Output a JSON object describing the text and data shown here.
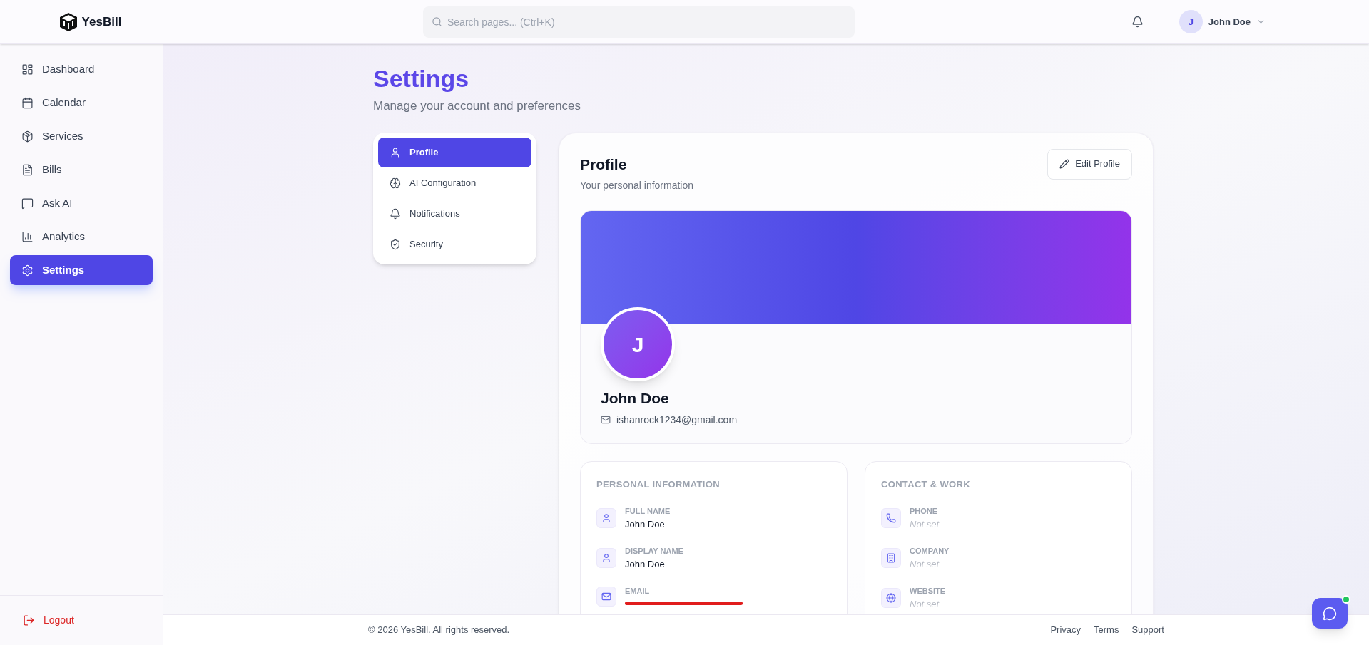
{
  "header": {
    "logo": "YesBill",
    "search": {
      "placeholder": "Search pages... (Ctrl+K)"
    },
    "user": {
      "initial": "J",
      "name": "John Doe"
    }
  },
  "sidebar": {
    "items": [
      {
        "label": "Dashboard",
        "selected": false
      },
      {
        "label": "Calendar",
        "selected": false
      },
      {
        "label": "Services",
        "selected": false
      },
      {
        "label": "Bills",
        "selected": false
      },
      {
        "label": "Ask AI",
        "selected": false
      },
      {
        "label": "Analytics",
        "selected": false
      },
      {
        "label": "Settings",
        "selected": true
      }
    ],
    "logout": "Logout"
  },
  "page": {
    "title": "Settings",
    "subtitle": "Manage your account and preferences"
  },
  "settings_nav": [
    {
      "label": "Profile",
      "selected": true
    },
    {
      "label": "AI Configuration",
      "selected": false
    },
    {
      "label": "Notifications",
      "selected": false
    },
    {
      "label": "Security",
      "selected": false
    }
  ],
  "profile": {
    "title": "Profile",
    "subtitle": "Your personal information",
    "edit_button": "Edit Profile",
    "avatar_initial": "J",
    "name": "John Doe",
    "email": "ishanrock1234@gmail.com"
  },
  "sections": [
    {
      "title": "PERSONAL INFORMATION",
      "fields": [
        {
          "label": "FULL NAME",
          "value": "John Doe",
          "set": true
        },
        {
          "label": "DISPLAY NAME",
          "value": "John Doe",
          "set": true
        },
        {
          "label": "EMAIL",
          "redacted": true
        }
      ]
    },
    {
      "title": "CONTACT & WORK",
      "fields": [
        {
          "label": "PHONE",
          "value": "Not set",
          "set": false
        },
        {
          "label": "COMPANY",
          "value": "Not set",
          "set": false
        },
        {
          "label": "WEBSITE",
          "value": "Not set",
          "set": false
        }
      ]
    }
  ],
  "footer": {
    "copyright": "© 2026 YesBill. All rights reserved.",
    "links": [
      "Privacy",
      "Terms",
      "Support"
    ]
  }
}
